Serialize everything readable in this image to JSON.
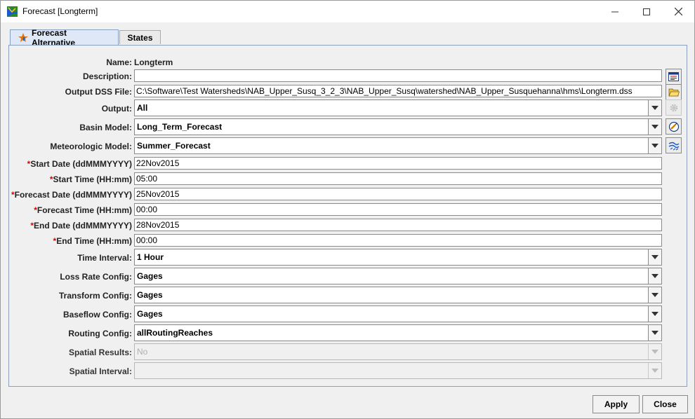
{
  "window": {
    "title": "Forecast [Longterm]",
    "icon": "watershed-app-icon"
  },
  "tabs": [
    {
      "label": "Forecast Alternative",
      "active": true,
      "icon": "forecast-icon"
    },
    {
      "label": "States",
      "active": false
    }
  ],
  "form": {
    "name": {
      "label": "Name:",
      "value": "Longterm"
    },
    "description": {
      "label": "Description:",
      "value": ""
    },
    "output_dss": {
      "label": "Output DSS File:",
      "value": "C:\\Software\\Test Watersheds\\NAB_Upper_Susq_3_2_3\\NAB_Upper_Susq\\watershed\\NAB_Upper_Susquehanna\\hms\\Longterm.dss"
    },
    "output": {
      "label": "Output:",
      "value": "All"
    },
    "basin_model": {
      "label": "Basin Model:",
      "value": "Long_Term_Forecast"
    },
    "met_model": {
      "label": "Meteorologic Model:",
      "value": "Summer_Forecast"
    },
    "start_date": {
      "req": "*",
      "label": "Start Date (ddMMMYYYY)",
      "value": "22Nov2015"
    },
    "start_time": {
      "req": "*",
      "label": "Start Time (HH:mm)",
      "value": "05:00"
    },
    "forecast_date": {
      "req": "*",
      "label": "Forecast Date (ddMMMYYYY)",
      "value": "25Nov2015"
    },
    "forecast_time": {
      "req": "*",
      "label": "Forecast Time (HH:mm)",
      "value": "00:00"
    },
    "end_date": {
      "req": "*",
      "label": "End Date (ddMMMYYYY)",
      "value": "28Nov2015"
    },
    "end_time": {
      "req": "*",
      "label": "End Time (HH:mm)",
      "value": "00:00"
    },
    "time_interval": {
      "label": "Time Interval:",
      "value": "1 Hour"
    },
    "loss_rate": {
      "label": "Loss Rate Config:",
      "value": "Gages"
    },
    "transform": {
      "label": "Transform Config:",
      "value": "Gages"
    },
    "baseflow": {
      "label": "Baseflow Config:",
      "value": "Gages"
    },
    "routing": {
      "label": "Routing Config:",
      "value": "allRoutingReaches"
    },
    "spatial_results": {
      "label": "Spatial Results:",
      "value": "No",
      "disabled": true
    },
    "spatial_interval": {
      "label": "Spatial Interval:",
      "value": "",
      "disabled": true
    }
  },
  "buttons": {
    "apply": "Apply",
    "close": "Close"
  },
  "colors": {
    "required_marker": "#e00000",
    "tab_active": "#dfe8f6",
    "panel_border": "#8aa0c0"
  }
}
